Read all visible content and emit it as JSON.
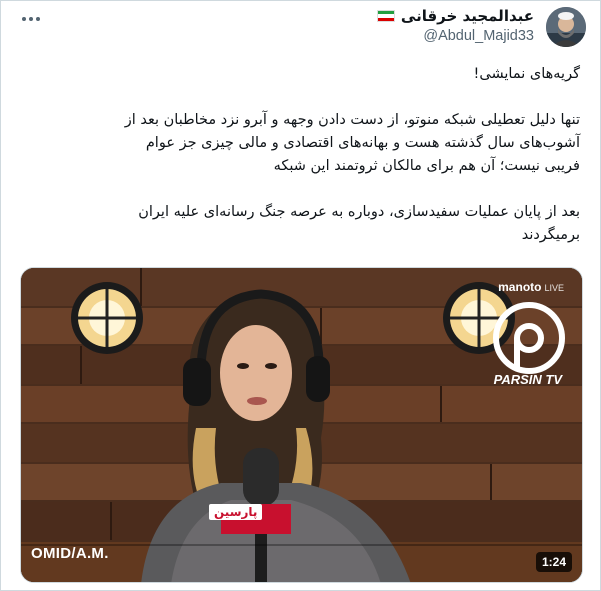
{
  "author": {
    "display_name": "عبدالمجید خرقانی",
    "handle": "@Abdul_Majid33",
    "flag_icon": "iran-flag-icon",
    "flag_colors": [
      "#239f40",
      "#ffffff",
      "#da0000"
    ]
  },
  "tweet": {
    "title_line": "گریه‌های نمایشی!",
    "paragraph_1": [
      "تنها دلیل تعطیلی شبکه منوتو، از دست دادن وجهه و آبرو نزد مخاطبان بعد از",
      "آشوب‌های سال گذشته هست و بهانه‌های اقتصادی و مالی چیزی جز عوام",
      "فریبی نیست؛ آن هم برای مالکان ثروتمند این شبکه"
    ],
    "paragraph_2": [
      "بعد از پایان عملیات سفیدسازی، دوباره به عرصه جنگ رسانه‌ای علیه ایران",
      "برمیگردند"
    ]
  },
  "video": {
    "duration": "1:24",
    "watermark": "OMID/A.M.",
    "channel_label": "manoto",
    "channel_live": "LIVE",
    "logo_text": "PARSIN TV",
    "mic_label": "پارسین"
  },
  "colors": {
    "text": "#0f1419",
    "secondary": "#536471",
    "parsin_red": "#c8102e"
  }
}
